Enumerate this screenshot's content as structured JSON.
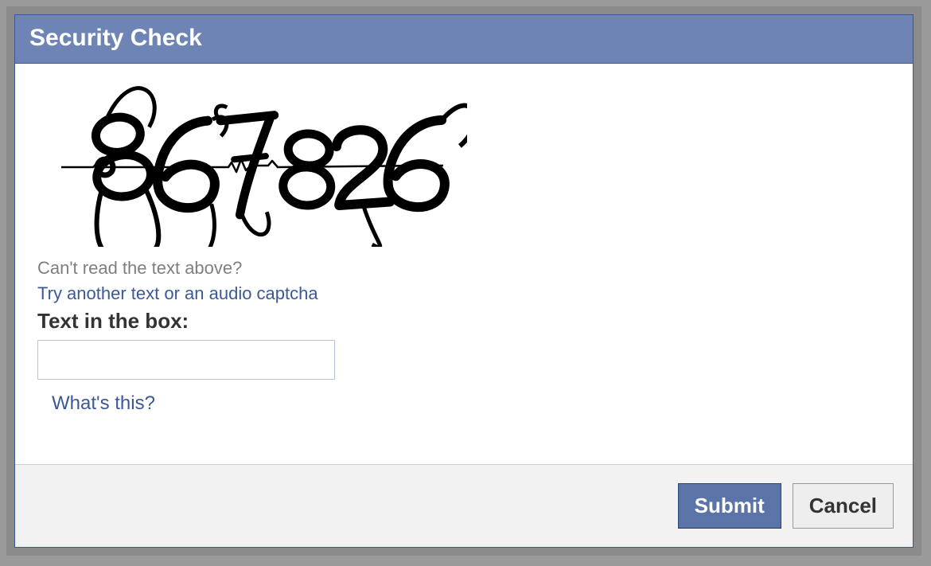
{
  "dialog": {
    "title": "Security Check",
    "captcha_text": "867826",
    "cant_read_label": "Can't read the text above?",
    "try_another_label": "Try another text or an audio captcha",
    "input_label": "Text in the box:",
    "help_label": "What's this?",
    "input_value": "",
    "submit_label": "Submit",
    "cancel_label": "Cancel"
  },
  "colors": {
    "header_bg": "#6d84b4",
    "link": "#3b5998"
  }
}
